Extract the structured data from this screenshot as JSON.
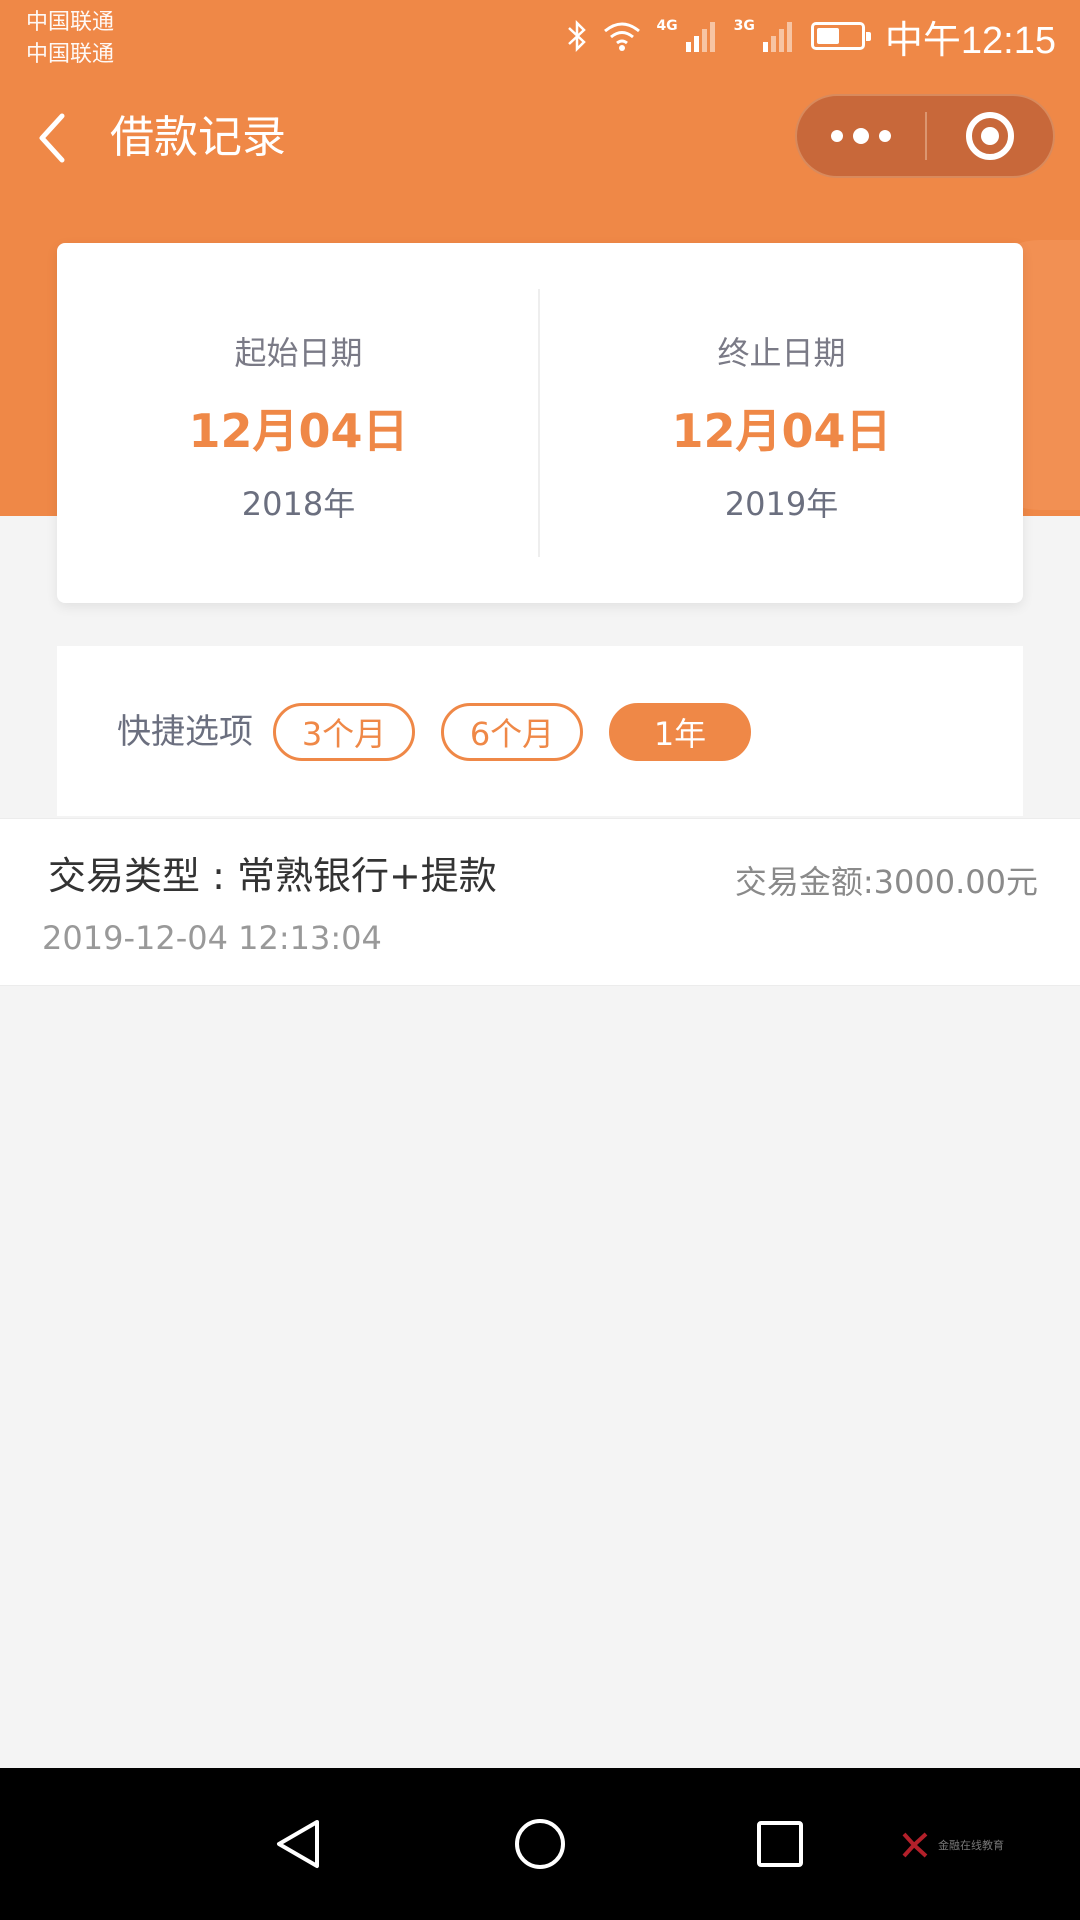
{
  "status_bar": {
    "carrier_1": "中国联通",
    "carrier_2": "中国联通",
    "signal_1_label": "4G",
    "signal_2_label": "3G",
    "time": "中午12:15",
    "icons": [
      "bluetooth-icon",
      "wifi-icon",
      "signal-4g-icon",
      "signal-3g-icon",
      "battery-icon"
    ]
  },
  "nav": {
    "title": "借款记录",
    "back_icon": "chevron-left-icon",
    "more_icon": "more-dots-icon",
    "close_icon": "target-circle-icon"
  },
  "date_range": {
    "start": {
      "label": "起始日期",
      "date": "12月04日",
      "year": "2018年"
    },
    "end": {
      "label": "终止日期",
      "date": "12月04日",
      "year": "2019年"
    }
  },
  "quick_options": {
    "label": "快捷选项",
    "options": [
      {
        "label": "3个月",
        "selected": false
      },
      {
        "label": "6个月",
        "selected": false
      },
      {
        "label": "1年",
        "selected": true
      }
    ]
  },
  "transactions": [
    {
      "type": "交易类型 : 常熟银行+提款",
      "time": "2019-12-04 12:13:04",
      "amount": "交易金额:3000.00元"
    }
  ],
  "system_nav": {
    "icons": [
      "back-triangle-icon",
      "home-circle-icon",
      "recents-square-icon"
    ],
    "watermark": "金融在线教育"
  },
  "colors": {
    "accent": "#ef8847",
    "background": "#f4f4f4",
    "card": "#ffffff"
  }
}
